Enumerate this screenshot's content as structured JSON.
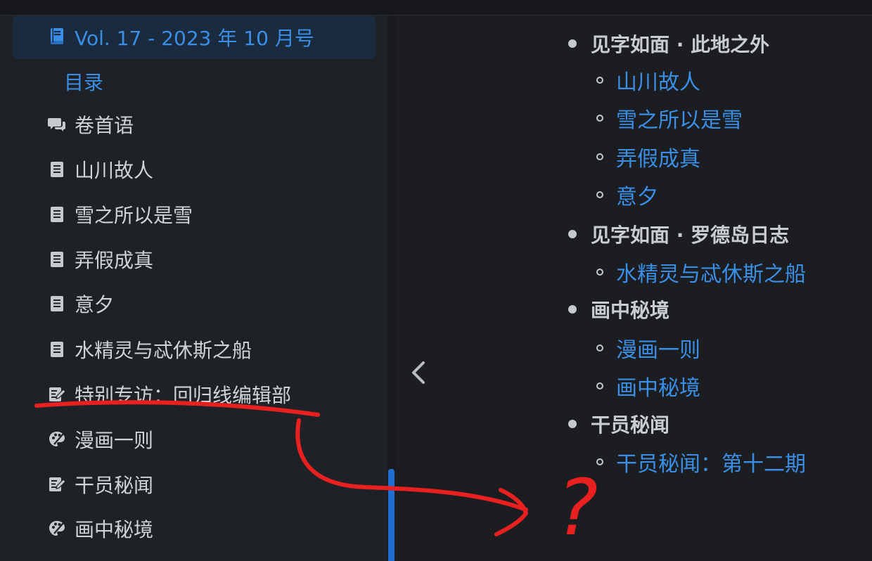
{
  "sidebar": {
    "volume": {
      "label": "Vol. 17 - 2023 年 10 月号",
      "icon": "book-icon"
    },
    "toc_label": "目录",
    "items": [
      {
        "label": "卷首语",
        "icon": "chat-bubbles-icon"
      },
      {
        "label": "山川故人",
        "icon": "document-icon"
      },
      {
        "label": "雪之所以是雪",
        "icon": "document-icon"
      },
      {
        "label": "弄假成真",
        "icon": "document-icon"
      },
      {
        "label": "意夕",
        "icon": "document-icon"
      },
      {
        "label": "水精灵与忒休斯之船",
        "icon": "document-icon"
      },
      {
        "label": "特别专访：回归线编辑部",
        "icon": "interview-icon"
      },
      {
        "label": "漫画一则",
        "icon": "palette-icon"
      },
      {
        "label": "干员秘闻",
        "icon": "interview-icon"
      },
      {
        "label": "画中秘境",
        "icon": "palette-icon"
      }
    ]
  },
  "content": {
    "sections": [
      {
        "title": "见字如面 · 此地之外",
        "items": [
          "山川故人",
          "雪之所以是雪",
          "弄假成真",
          "意夕"
        ]
      },
      {
        "title": "见字如面 · 罗德岛日志",
        "items": [
          "水精灵与忒休斯之船"
        ]
      },
      {
        "title": "画中秘境",
        "items": [
          "漫画一则",
          "画中秘境"
        ]
      },
      {
        "title": "干员秘闻",
        "items": [
          "干员秘闻：第十二期"
        ]
      }
    ]
  },
  "annotation": {
    "mark": "?",
    "color": "#e8201f"
  },
  "colors": {
    "accent": "#3a8ee6",
    "sidebar_bg": "#1e2125",
    "content_bg": "#1b1d21",
    "selected_bg": "#1a2b3f",
    "scroll_indicator": "#1f6fd1",
    "annotation": "#e8201f"
  }
}
